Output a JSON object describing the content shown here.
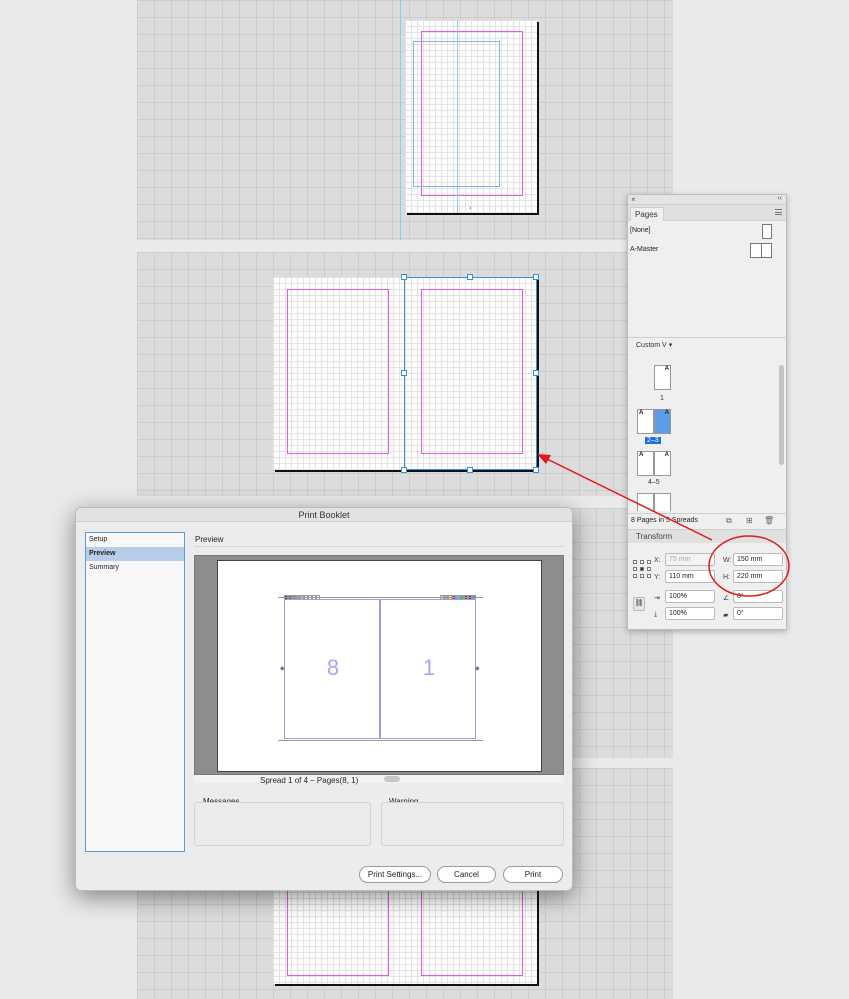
{
  "pages_panel": {
    "tab_label": "Pages",
    "masters": [
      "[None]",
      "A-Master"
    ],
    "view_menu": "Custom V",
    "thumbs": [
      {
        "label": "1",
        "prefix": "A",
        "selected": false
      },
      {
        "label": "2–3",
        "prefix": "A",
        "selected": true
      },
      {
        "label": "4–5",
        "prefix": "A",
        "selected": false
      }
    ],
    "status": "8 Pages in 5 Spreads"
  },
  "transform": {
    "title": "Transform",
    "x_label": "X:",
    "x_value": "75 mm",
    "y_label": "Y:",
    "y_value": "110 mm",
    "w_label": "W:",
    "w_value": "150 mm",
    "h_label": "H:",
    "h_value": "220 mm",
    "scale_x": "100%",
    "scale_y": "100%",
    "rotate": "0°",
    "shear": "0°"
  },
  "dialog": {
    "title": "Print Booklet",
    "nav": [
      "Setup",
      "Preview",
      "Summary"
    ],
    "selected_nav": "Preview",
    "section_title": "Preview",
    "preview_left_page": "8",
    "preview_right_page": "1",
    "spread_text": "Spread 1 of 4 – Pages(8, 1)",
    "messages_label": "Messages",
    "warning_label": "Warning",
    "btn_print_settings": "Print Settings...",
    "btn_cancel": "Cancel",
    "btn_print": "Print"
  },
  "canvas": {
    "page_number": "1"
  },
  "colors": {
    "accent": "#1e6fd9",
    "margin_guide": "#e15ae1",
    "column_guide": "#7ab6ea",
    "annotation": "#e01a1a"
  }
}
